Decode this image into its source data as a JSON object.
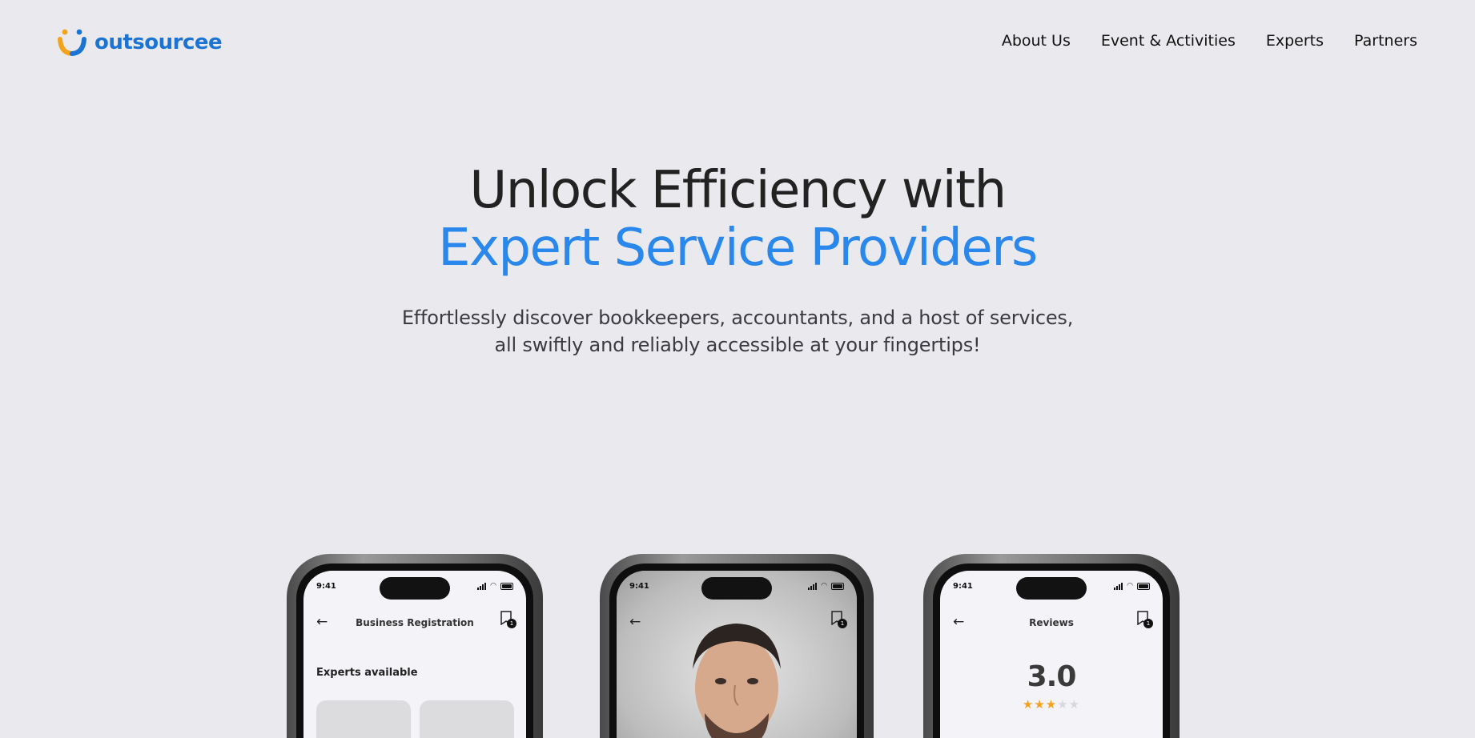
{
  "brand": {
    "name": "outsourcee",
    "colors": {
      "primary": "#1b74d3",
      "accent": "#f3a21b",
      "heading_blue": "#2a88ec"
    }
  },
  "nav": {
    "items": [
      "About Us",
      "Event & Activities",
      "Experts",
      "Partners"
    ]
  },
  "hero": {
    "title_line1": "Unlock Efficiency with",
    "title_line2": "Expert Service Providers",
    "subtitle_line1": "Effortlessly discover bookkeepers, accountants, and a host of services,",
    "subtitle_line2": "all swiftly and reliably accessible at your fingertips!"
  },
  "phones": {
    "left": {
      "time": "9:41",
      "title": "Business Registration",
      "badge": "1",
      "section": "Experts available",
      "back_icon": "arrow-left-icon",
      "bookmark_icon": "bookmark-icon"
    },
    "center": {
      "time": "9:41",
      "badge": "1",
      "back_icon": "arrow-left-icon",
      "bookmark_icon": "bookmark-icon",
      "content": "expert-portrait-photo"
    },
    "right": {
      "time": "9:41",
      "title": "Reviews",
      "badge": "1",
      "rating": "3.0",
      "stars_filled": 3,
      "stars_total": 5,
      "back_icon": "arrow-left-icon",
      "bookmark_icon": "bookmark-icon"
    }
  }
}
